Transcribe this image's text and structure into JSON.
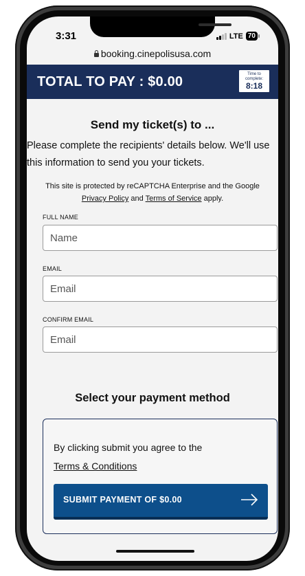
{
  "status_bar": {
    "time": "3:31",
    "network": "LTE",
    "battery": "70"
  },
  "browser": {
    "url": "booking.cinepolisusa.com"
  },
  "header": {
    "total_label": "TOTAL TO PAY : $0.00",
    "timer_label_1": "Time to",
    "timer_label_2": "complete:",
    "timer_value": "8:18"
  },
  "recipients": {
    "title": "Send my ticket(s) to ...",
    "intro": "Please complete the recipients' details below. We'll use this information to send you your tickets.",
    "recaptcha_prefix": "This site is protected by reCAPTCHA Enterprise and the Google",
    "privacy_link": "Privacy Policy",
    "and_text": "and",
    "terms_service_link": "Terms of Service",
    "apply_text": "apply."
  },
  "form": {
    "full_name_label": "FULL NAME",
    "full_name_placeholder": "Name",
    "email_label": "EMAIL",
    "email_placeholder": "Email",
    "confirm_email_label": "CONFIRM EMAIL",
    "confirm_email_placeholder": "Email"
  },
  "payment": {
    "title": "Select your payment method",
    "agree_text": "By clicking submit you agree to the",
    "terms_link": "Terms & Conditions",
    "submit_label": "SUBMIT PAYMENT OF $0.00"
  },
  "colors": {
    "header_bg": "#1a2e5a",
    "button_bg": "#0d4f8b",
    "screen_bg": "#f3f3f3"
  }
}
